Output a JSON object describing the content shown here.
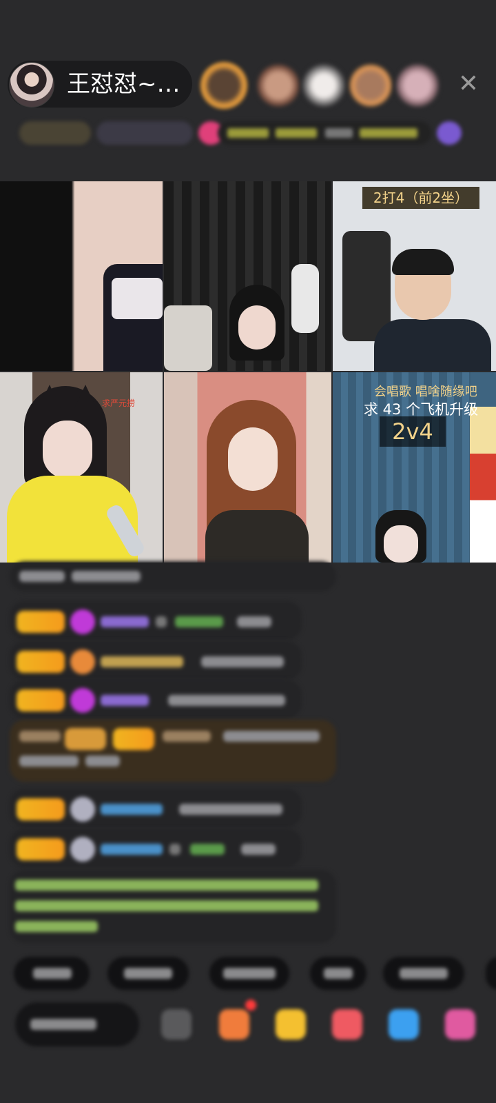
{
  "host": {
    "name": "王怼怼~…"
  },
  "close_icon": "close-icon",
  "video_tiles": [
    {
      "overlay_text": ""
    },
    {
      "overlay_text": ""
    },
    {
      "overlay_text": "2打4（前2坐）"
    },
    {
      "overlay_text": "求严元捞"
    },
    {
      "overlay_text": ""
    },
    {
      "line1": "会唱歌   唱啥随缘吧",
      "line2": "求 43 个飞机升级",
      "vs": "2v4"
    }
  ],
  "colors": {
    "background": "#2a2a2c",
    "vip_badge": "#f0b420",
    "highlight_message": "#3a2e1e"
  }
}
